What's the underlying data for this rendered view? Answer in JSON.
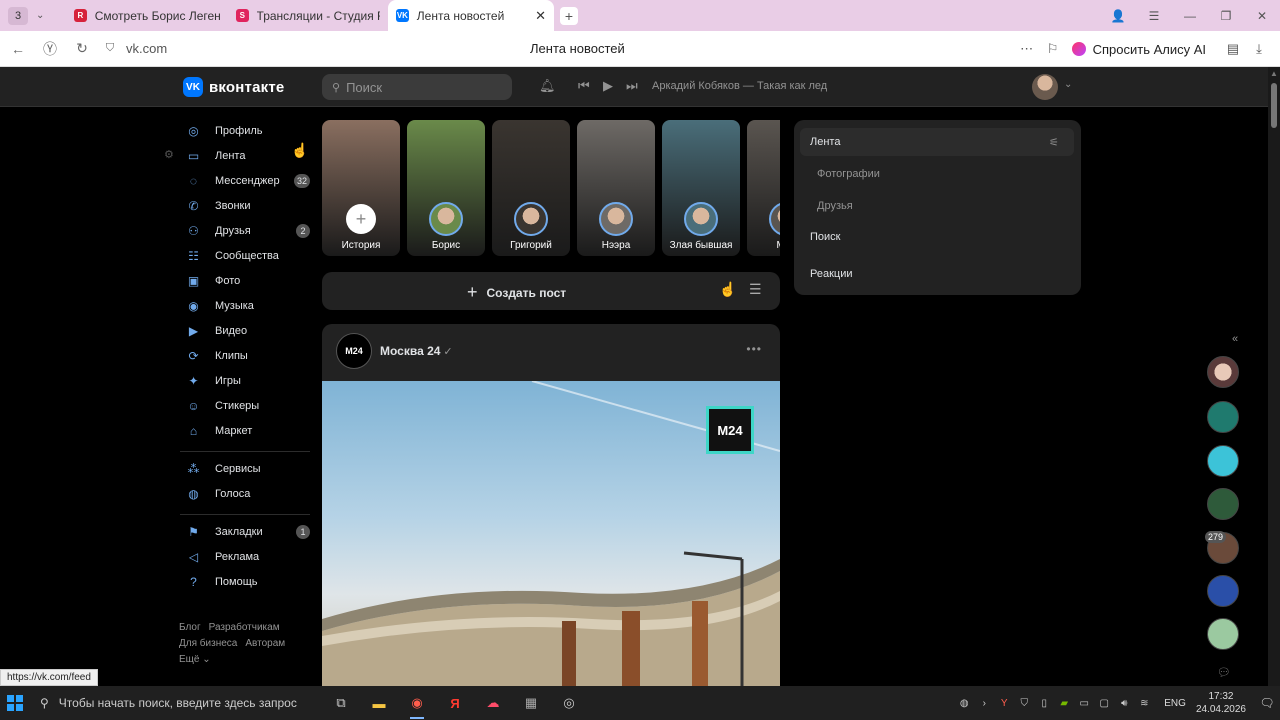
{
  "browser": {
    "tab_count": "3",
    "tabs": [
      {
        "label": "Смотреть Борис Легенда",
        "favicon_color": "#d6223b",
        "favicon_letter": "R"
      },
      {
        "label": "Трансляции - Студия RUT",
        "favicon_color": "#e0245e",
        "favicon_letter": "S"
      },
      {
        "label": "Лента новостей",
        "favicon_color": "#0077ff",
        "favicon_letter": "VK"
      }
    ],
    "url": "vk.com",
    "page_title": "Лента новостей",
    "alice_label": "Спросить Алису AI"
  },
  "vk": {
    "logo_text": "вконтакте",
    "search_placeholder": "Поиск",
    "now_playing": "Аркадий Кобяков — Такая как лед",
    "menu": [
      {
        "label": "Профиль",
        "icon": "profile-icon",
        "glyph": "◎"
      },
      {
        "label": "Лента",
        "icon": "feed-icon",
        "glyph": "▭"
      },
      {
        "label": "Мессенджер",
        "icon": "messenger-icon",
        "glyph": "◌",
        "count": "32"
      },
      {
        "label": "Звонки",
        "icon": "calls-icon",
        "glyph": "✆"
      },
      {
        "label": "Друзья",
        "icon": "friends-icon",
        "glyph": "⚇",
        "count": "2"
      },
      {
        "label": "Сообщества",
        "icon": "communities-icon",
        "glyph": "☷"
      },
      {
        "label": "Фото",
        "icon": "photo-icon",
        "glyph": "▣"
      },
      {
        "label": "Музыка",
        "icon": "music-icon",
        "glyph": "◉"
      },
      {
        "label": "Видео",
        "icon": "video-icon",
        "glyph": "▶"
      },
      {
        "label": "Клипы",
        "icon": "clips-icon",
        "glyph": "⟳"
      },
      {
        "label": "Игры",
        "icon": "games-icon",
        "glyph": "✦"
      },
      {
        "label": "Стикеры",
        "icon": "stickers-icon",
        "glyph": "☺"
      },
      {
        "label": "Маркет",
        "icon": "market-icon",
        "glyph": "⌂"
      }
    ],
    "menu2": [
      {
        "label": "Сервисы",
        "icon": "services-icon",
        "glyph": "⁂"
      },
      {
        "label": "Голоса",
        "icon": "votes-icon",
        "glyph": "◍"
      }
    ],
    "menu3": [
      {
        "label": "Закладки",
        "icon": "bookmarks-icon",
        "glyph": "⚑",
        "count": "1"
      },
      {
        "label": "Реклама",
        "icon": "ads-icon",
        "glyph": "◁"
      },
      {
        "label": "Помощь",
        "icon": "help-icon",
        "glyph": "?"
      }
    ],
    "footer": {
      "blog": "Блог",
      "developers": "Разработчикам",
      "business": "Для бизнеса",
      "authors": "Авторам",
      "more": "Ещё ⌄"
    },
    "stories": [
      {
        "name": "История",
        "bg": "#8a6f60"
      },
      {
        "name": "Борис",
        "bg": "#6a8a4a"
      },
      {
        "name": "Григорий",
        "bg": "#3a3530"
      },
      {
        "name": "Нээра",
        "bg": "#6e6a66"
      },
      {
        "name": "Злая бывшая",
        "bg": "#4a6e7a"
      },
      {
        "name": "Мос",
        "bg": "#5a5550"
      }
    ],
    "create_post": "Создать пост",
    "post": {
      "author": "Москва 24",
      "avatar_text": "M24",
      "badge_text": "M24"
    },
    "filters": {
      "feed": "Лента",
      "photos": "Фотографии",
      "friends": "Друзья",
      "search": "Поиск",
      "reactions": "Реакции"
    },
    "dock_badge": "279"
  },
  "status_url": "https://vk.com/feed",
  "taskbar": {
    "search_placeholder": "Чтобы начать поиск, введите здесь запрос",
    "lang": "ENG",
    "time": "17:32",
    "date": "24.04.2026"
  }
}
